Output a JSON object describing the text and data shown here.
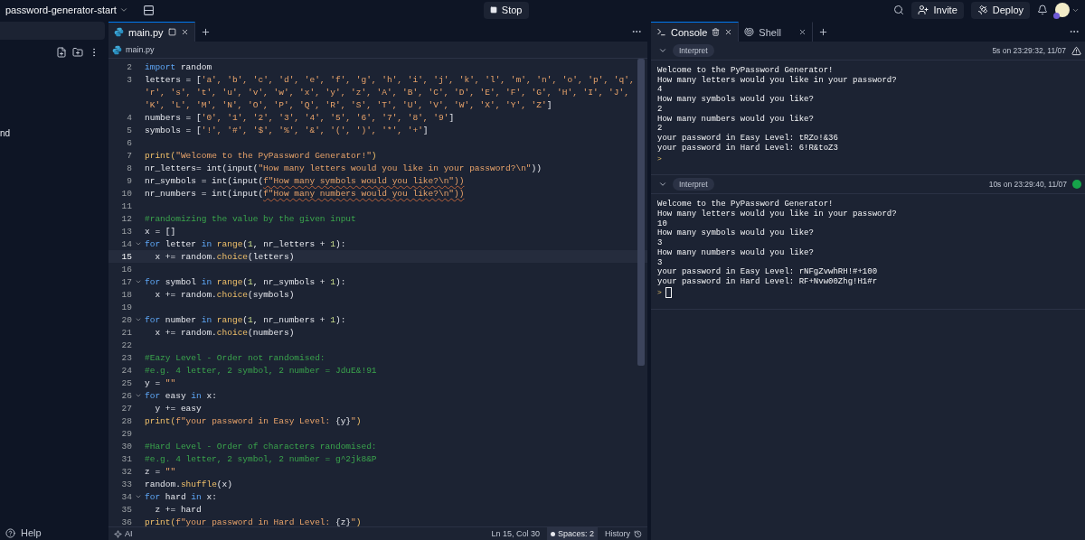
{
  "topbar": {
    "project": "password-generator-start",
    "stop": "Stop",
    "invite": "Invite",
    "deploy": "Deploy"
  },
  "sidebar": {
    "items": [
      {
        "label": "nd"
      }
    ],
    "help": "Help"
  },
  "editor": {
    "tabs": [
      {
        "label": "main.py",
        "selected": true
      }
    ],
    "breadcrumb": "main.py",
    "lines": [
      {
        "num": "2",
        "tokens": [
          {
            "text": "import",
            "kind": "keyword"
          },
          {
            "text": " random",
            "kind": "plain"
          }
        ]
      },
      {
        "num": "3",
        "tokens": [
          {
            "text": "letters = [",
            "kind": "plain"
          },
          {
            "text": "'a', 'b', 'c', 'd', 'e', 'f', 'g', 'h', 'i', 'j', 'k', 'l', 'm', 'n', 'o', 'p', 'q',",
            "kind": "string"
          }
        ]
      },
      {
        "tokens": [
          {
            "text": "'r', 's', 't', 'u', 'v', 'w', 'x', 'y', 'z', 'A', 'B', 'C', 'D', 'E', 'F', 'G', 'H', 'I', 'J',",
            "kind": "string"
          }
        ]
      },
      {
        "tokens": [
          {
            "text": "'K', 'L', 'M', 'N', 'O', 'P', 'Q', 'R', 'S', 'T', 'U', 'V', 'W', 'X', 'Y', 'Z'",
            "kind": "string"
          },
          {
            "text": "]",
            "kind": "plain"
          }
        ]
      },
      {
        "num": "4",
        "tokens": [
          {
            "text": "numbers = [",
            "kind": "plain"
          },
          {
            "text": "'0', '1', '2', '3', '4', '5', '6', '7', '8', '9'",
            "kind": "string"
          },
          {
            "text": "]",
            "kind": "plain"
          }
        ]
      },
      {
        "num": "5",
        "tokens": [
          {
            "text": "symbols = [",
            "kind": "plain"
          },
          {
            "text": "'!', '#', '$', '%', '&', '(', ')', '*', '+'",
            "kind": "string"
          },
          {
            "text": "]",
            "kind": "plain"
          }
        ]
      },
      {
        "num": "6"
      },
      {
        "num": "7",
        "tokens": [
          {
            "text": "print(",
            "kind": "function"
          },
          {
            "text": "\"Welcome to the PyPassword Generator!\"",
            "kind": "string"
          },
          {
            "text": ")",
            "kind": "function"
          }
        ]
      },
      {
        "num": "8",
        "tokens": [
          {
            "text": "nr_letters= int(input(",
            "kind": "plain"
          },
          {
            "text": "\"How many letters would you like in your password?\\n\"",
            "kind": "string"
          },
          {
            "text": "))",
            "kind": "plain"
          }
        ]
      },
      {
        "num": "9",
        "tokens": [
          {
            "text": "nr_symbols = int(input(",
            "kind": "plain"
          },
          {
            "text": "f\"How many symbols would you like?\\n\"))",
            "kind": "squiggly"
          }
        ]
      },
      {
        "num": "10",
        "tokens": [
          {
            "text": "nr_numbers = int(input(",
            "kind": "plain"
          },
          {
            "text": "f\"How many numbers would you like?\\n\"))",
            "kind": "squiggly"
          }
        ]
      },
      {
        "num": "11"
      },
      {
        "num": "12",
        "tokens": [
          {
            "text": "#randomizing the value by the given input",
            "kind": "comment"
          }
        ]
      },
      {
        "num": "13",
        "tokens": [
          {
            "text": "x = []",
            "kind": "plain"
          }
        ]
      },
      {
        "num": "14",
        "fold": true,
        "tokens": [
          {
            "text": "for",
            "kind": "keyword"
          },
          {
            "text": " letter ",
            "kind": "plain"
          },
          {
            "text": "in",
            "kind": "keyword"
          },
          {
            "text": " range",
            "kind": "function"
          },
          {
            "text": "(",
            "kind": "plain"
          },
          {
            "text": "1",
            "kind": "number"
          },
          {
            "text": ", nr_letters + ",
            "kind": "plain"
          },
          {
            "text": "1",
            "kind": "number"
          },
          {
            "text": "):",
            "kind": "plain"
          }
        ]
      },
      {
        "num": "15",
        "current": true,
        "tokens": [
          {
            "text": "  x += random.",
            "kind": "plain"
          },
          {
            "text": "choice",
            "kind": "function"
          },
          {
            "text": "(letters)",
            "kind": "plain"
          }
        ]
      },
      {
        "num": "16"
      },
      {
        "num": "17",
        "fold": true,
        "tokens": [
          {
            "text": "for",
            "kind": "keyword"
          },
          {
            "text": " symbol ",
            "kind": "plain"
          },
          {
            "text": "in",
            "kind": "keyword"
          },
          {
            "text": " range",
            "kind": "function"
          },
          {
            "text": "(",
            "kind": "plain"
          },
          {
            "text": "1",
            "kind": "number"
          },
          {
            "text": ", nr_symbols + ",
            "kind": "plain"
          },
          {
            "text": "1",
            "kind": "number"
          },
          {
            "text": "):",
            "kind": "plain"
          }
        ]
      },
      {
        "num": "18",
        "tokens": [
          {
            "text": "  x += random.",
            "kind": "plain"
          },
          {
            "text": "choice",
            "kind": "function"
          },
          {
            "text": "(symbols)",
            "kind": "plain"
          }
        ]
      },
      {
        "num": "19"
      },
      {
        "num": "20",
        "fold": true,
        "tokens": [
          {
            "text": "for",
            "kind": "keyword"
          },
          {
            "text": " number ",
            "kind": "plain"
          },
          {
            "text": "in",
            "kind": "keyword"
          },
          {
            "text": " range",
            "kind": "function"
          },
          {
            "text": "(",
            "kind": "plain"
          },
          {
            "text": "1",
            "kind": "number"
          },
          {
            "text": ", nr_numbers + ",
            "kind": "plain"
          },
          {
            "text": "1",
            "kind": "number"
          },
          {
            "text": "):",
            "kind": "plain"
          }
        ]
      },
      {
        "num": "21",
        "tokens": [
          {
            "text": "  x += random.",
            "kind": "plain"
          },
          {
            "text": "choice",
            "kind": "function"
          },
          {
            "text": "(numbers)",
            "kind": "plain"
          }
        ]
      },
      {
        "num": "22"
      },
      {
        "num": "23",
        "tokens": [
          {
            "text": "#Eazy Level - Order not randomised:",
            "kind": "comment"
          }
        ]
      },
      {
        "num": "24",
        "tokens": [
          {
            "text": "#e.g. 4 letter, 2 symbol, 2 number = JduE&!91",
            "kind": "comment"
          }
        ]
      },
      {
        "num": "25",
        "tokens": [
          {
            "text": "y = ",
            "kind": "plain"
          },
          {
            "text": "\"\"",
            "kind": "string"
          }
        ]
      },
      {
        "num": "26",
        "fold": true,
        "tokens": [
          {
            "text": "for",
            "kind": "keyword"
          },
          {
            "text": " easy ",
            "kind": "plain"
          },
          {
            "text": "in",
            "kind": "keyword"
          },
          {
            "text": " x:",
            "kind": "plain"
          }
        ]
      },
      {
        "num": "27",
        "tokens": [
          {
            "text": "  y += easy",
            "kind": "plain"
          }
        ]
      },
      {
        "num": "28",
        "tokens": [
          {
            "text": "print(",
            "kind": "function"
          },
          {
            "text": "f\"your password in Easy Level: ",
            "kind": "string"
          },
          {
            "text": "{y}",
            "kind": "plain"
          },
          {
            "text": "\"",
            "kind": "string"
          },
          {
            "text": ")",
            "kind": "function"
          }
        ]
      },
      {
        "num": "29"
      },
      {
        "num": "30",
        "tokens": [
          {
            "text": "#Hard Level - Order of characters randomised:",
            "kind": "comment"
          }
        ]
      },
      {
        "num": "31",
        "tokens": [
          {
            "text": "#e.g. 4 letter, 2 symbol, 2 number = g^2jk8&P",
            "kind": "comment"
          }
        ]
      },
      {
        "num": "32",
        "tokens": [
          {
            "text": "z = ",
            "kind": "plain"
          },
          {
            "text": "\"\"",
            "kind": "string"
          }
        ]
      },
      {
        "num": "33",
        "tokens": [
          {
            "text": "random.",
            "kind": "plain"
          },
          {
            "text": "shuffle",
            "kind": "function"
          },
          {
            "text": "(x)",
            "kind": "plain"
          }
        ]
      },
      {
        "num": "34",
        "fold": true,
        "tokens": [
          {
            "text": "for",
            "kind": "keyword"
          },
          {
            "text": " hard ",
            "kind": "plain"
          },
          {
            "text": "in",
            "kind": "keyword"
          },
          {
            "text": " x:",
            "kind": "plain"
          }
        ]
      },
      {
        "num": "35",
        "tokens": [
          {
            "text": "  z += hard",
            "kind": "plain"
          }
        ]
      },
      {
        "num": "36",
        "tokens": [
          {
            "text": "print(",
            "kind": "function"
          },
          {
            "text": "f\"your password in Hard Level: ",
            "kind": "string"
          },
          {
            "text": "{z}",
            "kind": "plain"
          },
          {
            "text": "\"",
            "kind": "string"
          },
          {
            "text": ")",
            "kind": "function"
          }
        ]
      }
    ],
    "status": {
      "ai": "AI",
      "position": "Ln 15, Col 30",
      "spaces": "Spaces: 2",
      "history": "History"
    }
  },
  "console": {
    "tabs": [
      {
        "label": "Console",
        "kind": "console",
        "selected": true
      },
      {
        "label": "Shell",
        "kind": "shell",
        "selected": false
      }
    ],
    "runs": [
      {
        "label": "Interpret",
        "time": "5s on 23:29:32, 11/07",
        "kind": "warning",
        "prompt": ">",
        "cursor": false,
        "output": [
          "Welcome to the PyPassword Generator!",
          "How many letters would you like in your password?",
          "4",
          "How many symbols would you like?",
          "2",
          "How many numbers would you like?",
          "2",
          "your password in Easy Level: tRZo!&36",
          "your password in Hard Level: 6!R&toZ3"
        ]
      },
      {
        "label": "Interpret",
        "time": "10s on 23:29:40, 11/07",
        "kind": "success",
        "prompt": ">",
        "cursor": true,
        "output": [
          "Welcome to the PyPassword Generator!",
          "How many letters would you like in your password?",
          "10",
          "How many symbols would you like?",
          "3",
          "How many numbers would you like?",
          "3",
          "your password in Easy Level: rNFgZvwhRH!#+100",
          "your password in Hard Level: RF+Nvw00Zhg!H1#r"
        ]
      }
    ]
  }
}
